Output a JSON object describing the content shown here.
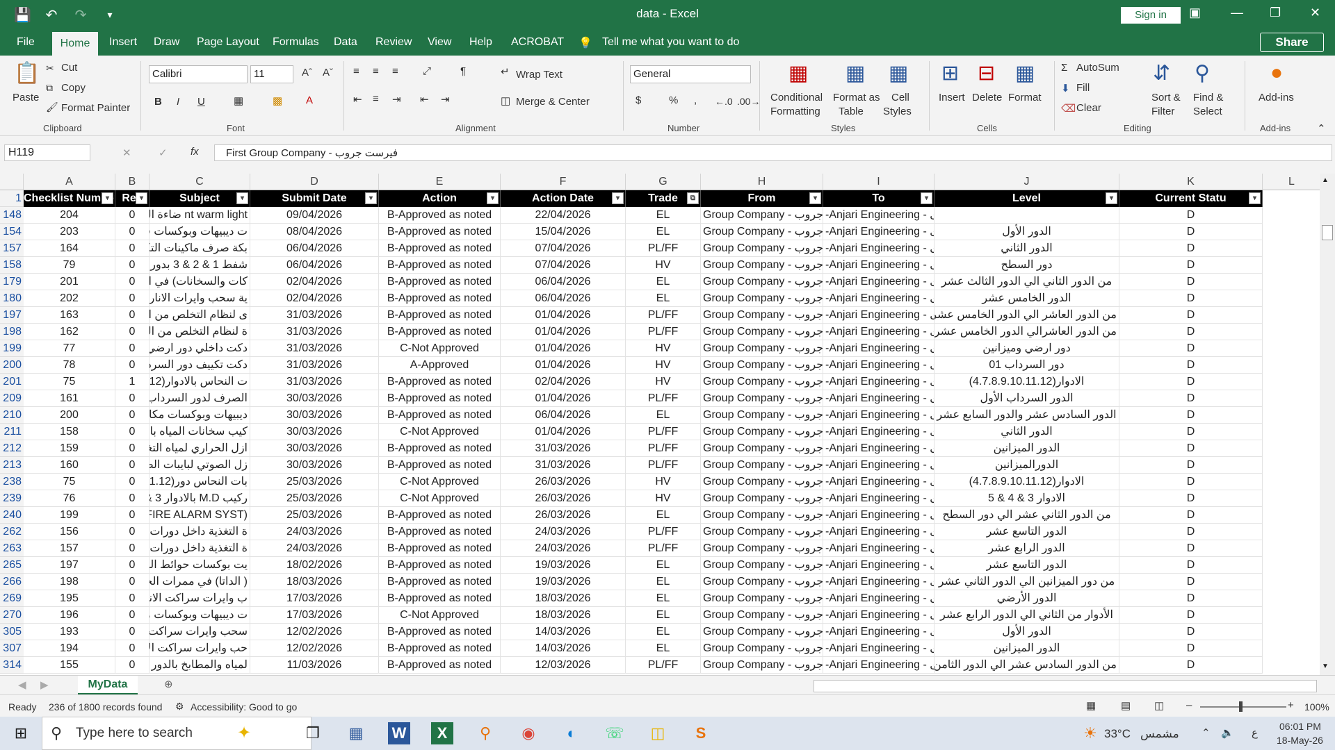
{
  "title_bar": {
    "title": "data  -  Excel",
    "signin": "Sign in",
    "qat_icons": [
      "save-icon",
      "undo-icon",
      "redo-icon",
      "customize-icon"
    ]
  },
  "menu": {
    "items": [
      "File",
      "Home",
      "Insert",
      "Draw",
      "Page Layout",
      "Formulas",
      "Data",
      "Review",
      "View",
      "Help",
      "ACROBAT"
    ],
    "tell_me": "Tell me what you want to do",
    "share": "Share"
  },
  "ribbon": {
    "clipboard": {
      "paste": "Paste",
      "cut": "Cut",
      "copy": "Copy",
      "format_painter": "Format Painter",
      "label": "Clipboard"
    },
    "font": {
      "name": "Calibri",
      "size": "11",
      "label": "Font",
      "b": "B",
      "i": "I",
      "u": "U"
    },
    "alignment": {
      "wrap": "Wrap Text",
      "merge": "Merge & Center",
      "label": "Alignment"
    },
    "number": {
      "format": "General",
      "label": "Number",
      "currency": "$",
      "percent": "%",
      "comma": ","
    },
    "styles": {
      "conditional": "Conditional",
      "conditional2": "Formatting",
      "format_as": "Format as",
      "format_as2": "Table",
      "cell": "Cell",
      "cell2": "Styles",
      "label": "Styles"
    },
    "cells": {
      "insert": "Insert",
      "delete": "Delete",
      "format": "Format",
      "label": "Cells"
    },
    "editing": {
      "autosum": "AutoSum",
      "fill": "Fill",
      "clear": "Clear",
      "sort": "Sort &",
      "sort2": "Filter",
      "find": "Find &",
      "find2": "Select",
      "label": "Editing"
    },
    "addins": {
      "addins": "Add-ins",
      "label": "Add-ins"
    }
  },
  "formula_bar": {
    "name_box": "H119",
    "fx": "fx",
    "content": "First Group Company - فيرست جروب"
  },
  "columns": [
    "A",
    "B",
    "C",
    "D",
    "E",
    "F",
    "G",
    "H",
    "I",
    "J",
    "K",
    "L"
  ],
  "headers": [
    "Checklist Number",
    "Rev",
    "Subject",
    "Submit Date",
    "Action",
    "Action Date",
    "Trade",
    "From",
    "To",
    "Level",
    "Current Statu"
  ],
  "rows": [
    {
      "r": "148",
      "a": "204",
      "b": "0",
      "c": "nt warm light ضاءة الخارجية",
      "d": "09/04/2026",
      "e": "B-Approved as noted",
      "f": "22/04/2026",
      "g": "EL",
      "h": "Group Company - جروب",
      "i": "-Anjari Engineering - ری",
      "j": "",
      "k": "D"
    },
    {
      "r": "154",
      "a": "203",
      "b": "0",
      "c": "ت ديبيهات وبوكسات في غرفة ال",
      "d": "08/04/2026",
      "e": "B-Approved as noted",
      "f": "15/04/2026",
      "g": "EL",
      "h": "Group Company - جروب",
      "i": "-Anjari Engineering - ری",
      "j": "الدور الأول",
      "k": "D"
    },
    {
      "r": "157",
      "a": "164",
      "b": "0",
      "c": "بكة صرف ماكينات التكييف بالد",
      "d": "06/04/2026",
      "e": "B-Approved as noted",
      "f": "07/04/2026",
      "g": "PL/FF",
      "h": "Group Company - جروب",
      "i": "-Anjari Engineering - ری",
      "j": "الدور الثاني",
      "k": "D"
    },
    {
      "r": "158",
      "a": "79",
      "b": "0",
      "c": "شفط 1 & 2 & 3 بدور السطح",
      "d": "06/04/2026",
      "e": "B-Approved as noted",
      "f": "07/04/2026",
      "g": "HV",
      "h": "Group Company - جروب",
      "i": "-Anjari Engineering - ری",
      "j": "دور السطح",
      "k": "D"
    },
    {
      "r": "179",
      "a": "201",
      "b": "0",
      "c": "كات والسخانات) في الممرات وا",
      "d": "02/04/2026",
      "e": "B-Approved as noted",
      "f": "06/04/2026",
      "g": "EL",
      "h": "Group Company - جروب",
      "i": "-Anjari Engineering - ری",
      "j": "من الدور الثاني الي الدور الثالث عشر",
      "k": "D"
    },
    {
      "r": "180",
      "a": "202",
      "b": "0",
      "c": "ية سحب وايرات الانارة والباور",
      "d": "02/04/2026",
      "e": "B-Approved as noted",
      "f": "06/04/2026",
      "g": "EL",
      "h": "Group Company - جروب",
      "i": "-Anjari Engineering - ری",
      "j": "الدور الخامس عشر",
      "k": "D"
    },
    {
      "r": "197",
      "a": "163",
      "b": "0",
      "c": "ى لنظام التخلص من النفايات (",
      "d": "31/03/2026",
      "e": "B-Approved as noted",
      "f": "01/04/2026",
      "g": "PL/FF",
      "h": "Group Company - جروب",
      "i": "-Anjari Engineering - ری",
      "j": "من الدور العاشر الي الدور الخامس عشر",
      "k": "D"
    },
    {
      "r": "198",
      "a": "162",
      "b": "0",
      "c": "ة لنظام التخلص من النفايات (",
      "d": "31/03/2026",
      "e": "B-Approved as noted",
      "f": "01/04/2026",
      "g": "PL/FF",
      "h": "Group Company - جروب",
      "i": "-Anjari Engineering - ری",
      "j": "من الدور العاشرالي الدور الخامس عشر",
      "k": "D"
    },
    {
      "r": "199",
      "a": "77",
      "b": "0",
      "c": "دكت داخلي دور ارضي وميزانين",
      "d": "31/03/2026",
      "e": "C-Not Approved",
      "f": "01/04/2026",
      "g": "HV",
      "h": "Group Company - جروب",
      "i": "-Anjari Engineering - ری",
      "j": "دور ارضي وميزانين",
      "k": "D"
    },
    {
      "r": "200",
      "a": "78",
      "b": "0",
      "c": "دكت تكييف دور السرداب 01",
      "d": "31/03/2026",
      "e": "A-Approved",
      "f": "01/04/2026",
      "g": "HV",
      "h": "Group Company - جروب",
      "i": "-Anjari Engineering - ری",
      "j": "دور السرداب 01",
      "k": "D"
    },
    {
      "r": "201",
      "a": "75",
      "b": "1",
      "c": "ت النحاس بالادوار(10.11.12",
      "d": "31/03/2026",
      "e": "B-Approved as noted",
      "f": "02/04/2026",
      "g": "HV",
      "h": "Group Company - جروب",
      "i": "-Anjari Engineering - ری",
      "j": "الادوار(4.7.8.9.10.11.12)",
      "k": "D"
    },
    {
      "r": "209",
      "a": "161",
      "b": "0",
      "c": "الصرف لدور السرداب الأول مع",
      "d": "30/03/2026",
      "e": "B-Approved as noted",
      "f": "01/04/2026",
      "g": "PL/FF",
      "h": "Group Company - جروب",
      "i": "-Anjari Engineering - ری",
      "j": "الدور السرداب الأول",
      "k": "D"
    },
    {
      "r": "210",
      "a": "200",
      "b": "0",
      "c": "ديبيهات وبوكسات مكاتب 1 و",
      "d": "30/03/2026",
      "e": "B-Approved as noted",
      "f": "06/04/2026",
      "g": "EL",
      "h": "Group Company - جروب",
      "i": "-Anjari Engineering - ری",
      "j": "الدور السادس عشر والدور السابع عشر",
      "k": "D"
    },
    {
      "r": "211",
      "a": "158",
      "b": "0",
      "c": "كيب سخانات المياه بالدور الثاني",
      "d": "30/03/2026",
      "e": "C-Not Approved",
      "f": "01/04/2026",
      "g": "PL/FF",
      "h": "Group Company - جروب",
      "i": "-Anjari Engineering - ری",
      "j": "الدور الثاني",
      "k": "D"
    },
    {
      "r": "212",
      "a": "159",
      "b": "0",
      "c": "ازل الحراري لمياه التغذية بدور",
      "d": "30/03/2026",
      "e": "B-Approved as noted",
      "f": "31/03/2026",
      "g": "PL/FF",
      "h": "Group Company - جروب",
      "i": "-Anjari Engineering - ری",
      "j": "الدور الميزانين",
      "k": "D"
    },
    {
      "r": "213",
      "a": "160",
      "b": "0",
      "c": "زل الصوتي لبايبات الصرف بدور",
      "d": "30/03/2026",
      "e": "B-Approved as noted",
      "f": "31/03/2026",
      "g": "PL/FF",
      "h": "Group Company - جروب",
      "i": "-Anjari Engineering - ری",
      "j": "الدورالميزانين",
      "k": "D"
    },
    {
      "r": "238",
      "a": "75",
      "b": "0",
      "c": "بات النحاس دور(9.10.11.12",
      "d": "25/03/2026",
      "e": "C-Not Approved",
      "f": "26/03/2026",
      "g": "HV",
      "h": "Group Company - جروب",
      "i": "-Anjari Engineering - ری",
      "j": "الادوار(4.7.8.9.10.11.12)",
      "k": "D"
    },
    {
      "r": "239",
      "a": "76",
      "b": "0",
      "c": "ركيب M.D بالادوار 3 & 4 & 5",
      "d": "25/03/2026",
      "e": "C-Not Approved",
      "f": "26/03/2026",
      "g": "HV",
      "h": "Group Company - جروب",
      "i": "-Anjari Engineering - ری",
      "j": "الادوار 3 & 4 & 5",
      "k": "D"
    },
    {
      "r": "240",
      "a": "199",
      "b": "0",
      "c": "(FIRE ALARM SYST من الدو",
      "d": "25/03/2026",
      "e": "B-Approved as noted",
      "f": "26/03/2026",
      "g": "EL",
      "h": "Group Company - جروب",
      "i": "-Anjari Engineering - ری",
      "j": "من الدور الثاني عشر الي دور السطح",
      "k": "D"
    },
    {
      "r": "262",
      "a": "156",
      "b": "0",
      "c": "ة التغذية داخل دورات المياه وال",
      "d": "24/03/2026",
      "e": "B-Approved as noted",
      "f": "24/03/2026",
      "g": "PL/FF",
      "h": "Group Company - جروب",
      "i": "-Anjari Engineering - ری",
      "j": "الدور التاسع عشر",
      "k": "D"
    },
    {
      "r": "263",
      "a": "157",
      "b": "0",
      "c": "ة التغذية داخل دورات المياه وا",
      "d": "24/03/2026",
      "e": "B-Approved as noted",
      "f": "24/03/2026",
      "g": "PL/FF",
      "h": "Group Company - جروب",
      "i": "-Anjari Engineering - ری",
      "j": "الدور الرابع عشر",
      "k": "D"
    },
    {
      "r": "265",
      "a": "197",
      "b": "0",
      "c": "يت بوكسات حوائط المطابخ وا",
      "d": "18/02/2026",
      "e": "B-Approved as noted",
      "f": "19/03/2026",
      "g": "EL",
      "h": "Group Company - جروب",
      "i": "-Anjari Engineering - ری",
      "j": "الدور التاسع عشر",
      "k": "D"
    },
    {
      "r": "266",
      "a": "198",
      "b": "0",
      "c": "( الداتا) في ممرات الخدمات من",
      "d": "18/03/2026",
      "e": "B-Approved as noted",
      "f": "19/03/2026",
      "g": "EL",
      "h": "Group Company - جروب",
      "i": "-Anjari Engineering - ری",
      "j": "من دور الميزانين الي الدور الثاني عشر",
      "k": "D"
    },
    {
      "r": "269",
      "a": "195",
      "b": "0",
      "c": "ب وايرات سراكت الانارة وانارة الط",
      "d": "17/03/2026",
      "e": "B-Approved as noted",
      "f": "18/03/2026",
      "g": "EL",
      "h": "Group Company - جروب",
      "i": "-Anjari Engineering - ری",
      "j": "الدور الأرضي",
      "k": "D"
    },
    {
      "r": "270",
      "a": "196",
      "b": "0",
      "c": "ت ديبيهات وبوكسات مكتب رق",
      "d": "17/03/2026",
      "e": "C-Not Approved",
      "f": "18/03/2026",
      "g": "EL",
      "h": "Group Company - جروب",
      "i": "-Anjari Engineering - ری",
      "j": "الأدوار من الثاني الي الدور الرابع عشر",
      "k": "D"
    },
    {
      "r": "305",
      "a": "193",
      "b": "0",
      "c": "سحب وايرات سراكت الانارة وانارة",
      "d": "12/02/2026",
      "e": "B-Approved as noted",
      "f": "14/03/2026",
      "g": "EL",
      "h": "Group Company - جروب",
      "i": "-Anjari Engineering - ری",
      "j": "الدور الأول",
      "k": "D"
    },
    {
      "r": "307",
      "a": "194",
      "b": "0",
      "c": "حب وايرات سراكت الانارة وانارة",
      "d": "12/02/2026",
      "e": "B-Approved as noted",
      "f": "14/03/2026",
      "g": "EL",
      "h": "Group Company - جروب",
      "i": "-Anjari Engineering - ری",
      "j": "الدور الميزانين",
      "k": "D"
    },
    {
      "r": "314",
      "a": "155",
      "b": "0",
      "c": "لمياه والمطابخ بالدور السادس ع",
      "d": "11/03/2026",
      "e": "B-Approved as noted",
      "f": "12/03/2026",
      "g": "PL/FF",
      "h": "Group Company - جروب",
      "i": "-Anjari Engineering - ری",
      "j": "من الدور السادس عشر الي الدور الثامن عشر",
      "k": "D"
    }
  ],
  "sheet": {
    "tab": "MyData"
  },
  "status": {
    "ready": "Ready",
    "records": "236 of 1800 records found",
    "accessibility": "Accessibility: Good to go",
    "zoom": "100%"
  },
  "taskbar": {
    "search": "Type here to search",
    "weather": "33°C",
    "weather_text": "مشمس",
    "lang": "ع",
    "time": "06:01 PM",
    "date": "18-May-26"
  }
}
